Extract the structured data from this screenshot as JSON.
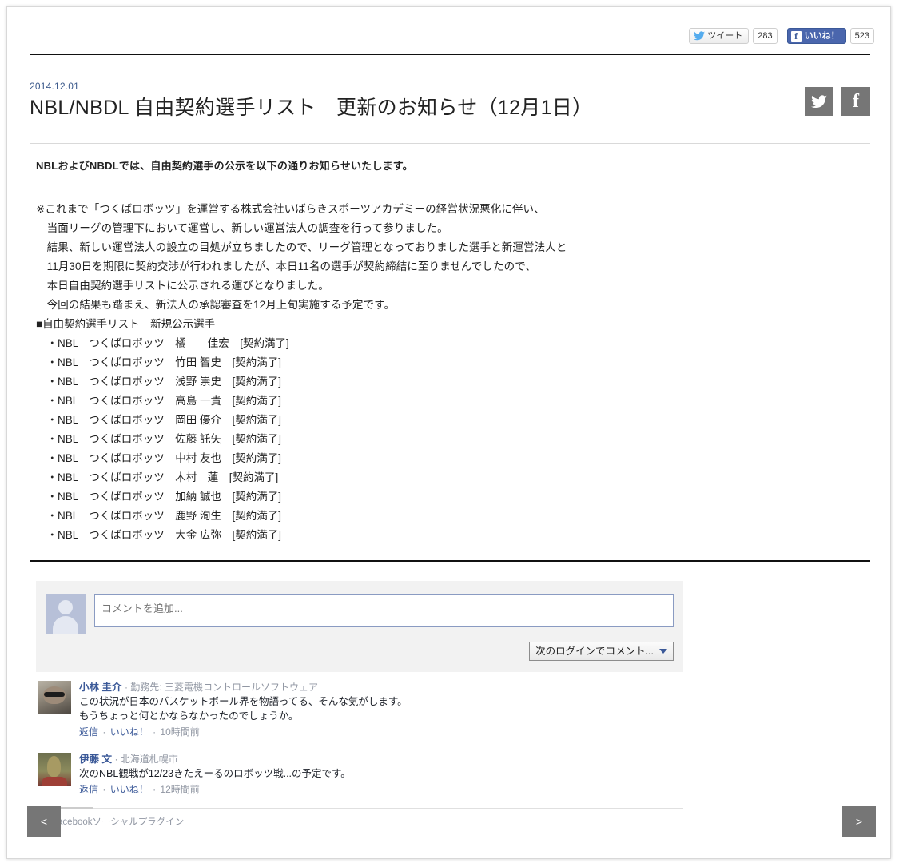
{
  "social_bar": {
    "tweet_label": "ツイート",
    "tweet_count": "283",
    "like_label": "いいね！",
    "like_count": "523",
    "twitter_icon": "twitter-bird-icon",
    "facebook_icon": "facebook-f-icon"
  },
  "article": {
    "date": "2014.12.01",
    "title": "NBL/NBDL 自由契約選手リスト　更新のお知らせ（12月1日）",
    "share": {
      "twitter_icon": "twitter-bird-icon",
      "facebook_icon": "facebook-f-icon",
      "facebook_glyph": "f"
    },
    "lead": "NBLおよびNBDLでは、自由契約選手の公示を以下の通りお知らせいたします。",
    "paragraph_lines": [
      "※これまで「つくばロボッツ」を運営する株式会社いばらきスポーツアカデミーの経営状況悪化に伴い、",
      "　当面リーグの管理下において運営し、新しい運営法人の調査を行って参りました。",
      "　結果、新しい運営法人の設立の目処が立ちましたので、リーグ管理となっておりました選手と新運営法人と",
      "　11月30日を期限に契約交渉が行われましたが、本日11名の選手が契約締結に至りませんでしたので、",
      "　本日自由契約選手リストに公示される運びとなりました。",
      "　今回の結果も踏まえ、新法人の承認審査を12月上旬実施する予定です。"
    ],
    "list_heading": "■自由契約選手リスト　新規公示選手",
    "players": [
      "　・NBL　つくばロボッツ　橘　　佳宏　[契約満了]",
      "　・NBL　つくばロボッツ　竹田 智史　[契約満了]",
      "　・NBL　つくばロボッツ　浅野 崇史　[契約満了]",
      "　・NBL　つくばロボッツ　高島 一貴　[契約満了]",
      "　・NBL　つくばロボッツ　岡田 優介　[契約満了]",
      "　・NBL　つくばロボッツ　佐藤 託矢　[契約満了]",
      "　・NBL　つくばロボッツ　中村 友也　[契約満了]",
      "　・NBL　つくばロボッツ　木村　蓮　[契約満了]",
      "　・NBL　つくばロボッツ　加納 誠也　[契約満了]",
      "　・NBL　つくばロボッツ　鹿野 洵生　[契約満了]",
      "　・NBL　つくばロボッツ　大金 広弥　[契約満了]"
    ]
  },
  "comments": {
    "composer_placeholder": "コメントを追加...",
    "login_label": "次のログインでコメント...",
    "avatar_name": "default-avatar",
    "items": [
      {
        "name": "小林 圭介",
        "meta": "· 勤務先: 三菱電機コントロールソフトウェア",
        "text_line1": "この状況が日本のバスケットボール界を物語ってる、そんな気がします。",
        "text_line2": "もうちょっと何とかならなかったのでしょうか。",
        "reply": "返信",
        "like": "いいね！",
        "time": "10時間前"
      },
      {
        "name": "伊藤 文",
        "meta": "· 北海道札幌市",
        "text_line1": "次のNBL観戦が12/23きたえーるのロボッツ戦...の予定です。",
        "text_line2": "",
        "reply": "返信",
        "like": "いいね！",
        "time": "12時間前"
      }
    ],
    "footer_label": "Facebookソーシャルプラグイン",
    "footer_glyph": "f"
  },
  "pager": {
    "prev_label": "<",
    "next_label": ">"
  }
}
